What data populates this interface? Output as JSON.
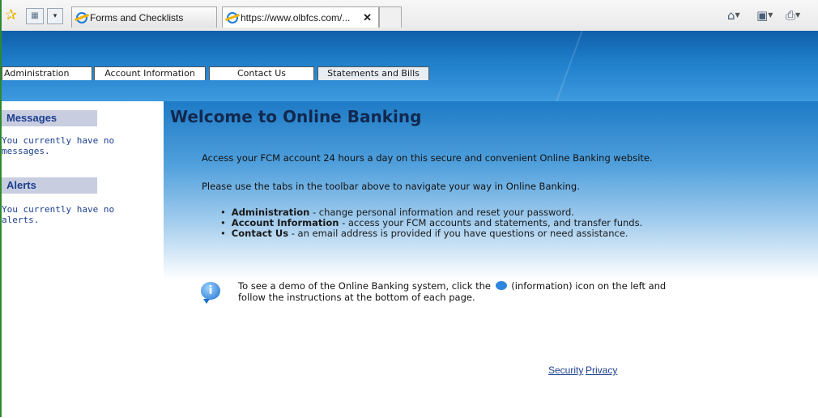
{
  "browser": {
    "tabs": [
      {
        "title": "Forms and Checklists"
      },
      {
        "title": "https://www.olbfcs.com/...",
        "close": "✕"
      }
    ],
    "icons": {
      "favorites": "favorites-star-icon",
      "quick_tabs": "quick-tabs-icon",
      "home": "home-icon",
      "feeds": "feeds-icon",
      "print": "print-icon"
    }
  },
  "nav": {
    "tabs": [
      "Administration",
      "Account Information",
      "Contact Us",
      "Statements and Bills"
    ]
  },
  "sidebar": {
    "messages_title": "Messages",
    "messages_text": "You currently have no messages.",
    "alerts_title": "Alerts",
    "alerts_text": "You currently have no alerts."
  },
  "main": {
    "title": "Welcome to Online Banking",
    "intro": "Access your FCM account 24 hours a day on this secure and convenient Online Banking website.",
    "nav_hint": "Please use the tabs in the toolbar above to navigate your way in Online Banking.",
    "features": [
      {
        "name": "Administration",
        "desc": " - change personal information and reset your password."
      },
      {
        "name": "Account Information",
        "desc": " - access your FCM accounts and statements, and transfer funds."
      },
      {
        "name": "Contact Us",
        "desc": " - an email address is provided if you have questions or need assistance."
      }
    ],
    "demo_before": "To see a demo of the Online Banking system, click the",
    "demo_after": "(information) icon on the left and follow the instructions at the bottom of each page."
  },
  "footer": {
    "security": "Security",
    "privacy": "Privacy"
  },
  "colors": {
    "banner": "#1f7fcb",
    "heading": "#12284f",
    "sidebar_header": "#c8cde0",
    "link": "#1b3f8f"
  }
}
